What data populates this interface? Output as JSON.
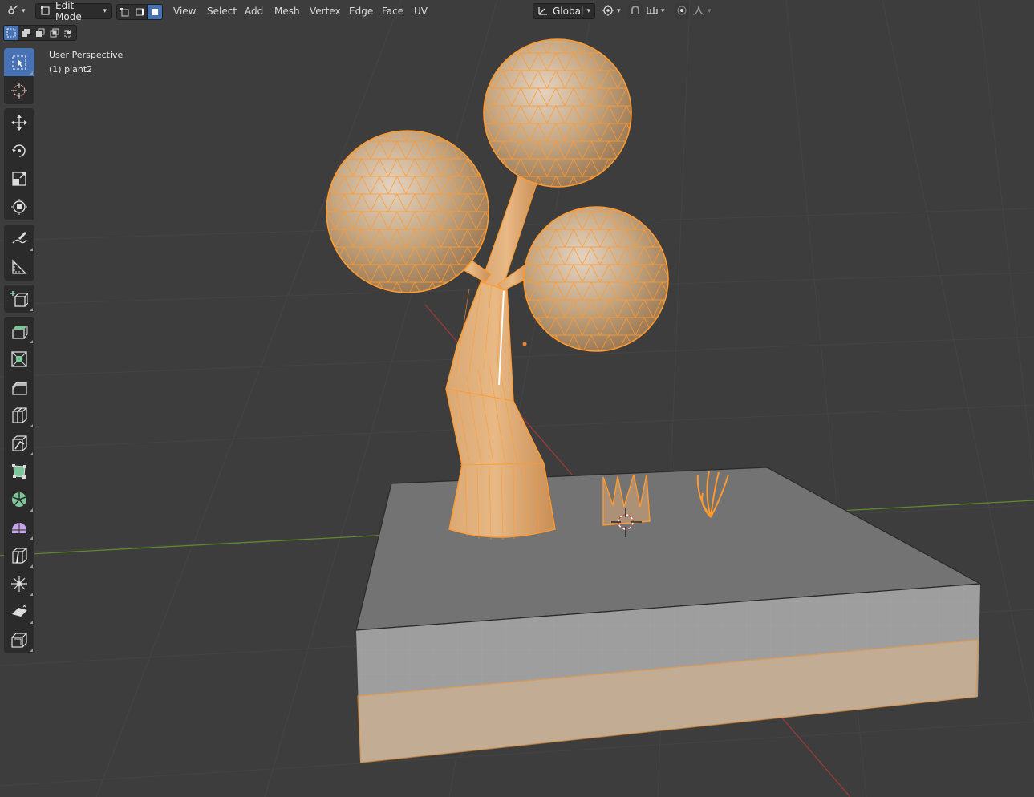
{
  "header": {
    "mode_label": "Edit Mode",
    "menus": [
      "View",
      "Select",
      "Add",
      "Mesh",
      "Vertex",
      "Edge",
      "Face",
      "UV"
    ],
    "transform_orientation": "Global"
  },
  "viewport": {
    "perspective_label": "User Perspective",
    "object_label": "(1) plant2"
  },
  "toolbar": {
    "tools": [
      "select-box",
      "cursor",
      "move",
      "rotate",
      "scale",
      "transform",
      "annotate",
      "measure",
      "add-cube",
      "extrude-region",
      "inset-faces",
      "bevel",
      "loop-cut",
      "knife",
      "poly-build",
      "spin",
      "smooth",
      "edge-slide",
      "shrink-fatten",
      "shear",
      "rip-region"
    ],
    "active_tool": "select-box"
  },
  "colors": {
    "accent": "#4772b3",
    "selection": "#ff9a2e",
    "background": "#3d3d3d",
    "grid": "#4a4a4a",
    "x_axis": "#9c3a3a",
    "y_axis": "#5f8a2c"
  }
}
